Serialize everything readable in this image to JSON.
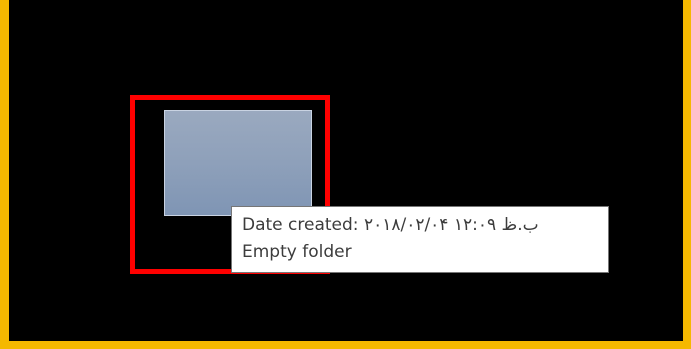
{
  "tooltip": {
    "date_label": "Date created:",
    "date_value": "۲۰۱۸/۰۲/۰۴ ب.ظ ۱۲:۰۹",
    "status": "Empty folder"
  },
  "icons": {
    "folder": "folder-thumbnail-icon"
  },
  "colors": {
    "background": "#000000",
    "border_accent": "#f5b800",
    "highlight": "#ff0000",
    "tooltip_bg": "#ffffff",
    "tooltip_text": "#3c3c3c"
  }
}
